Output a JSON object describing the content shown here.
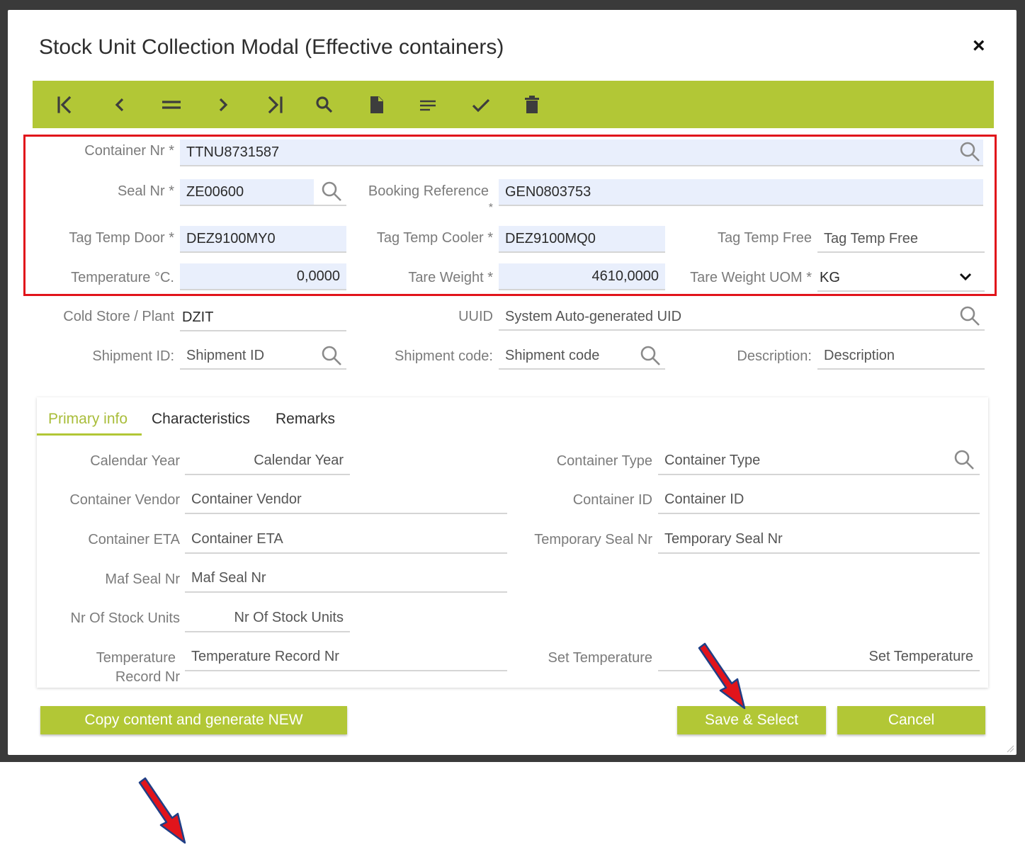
{
  "modal": {
    "title": "Stock Unit Collection Modal (Effective containers)",
    "close_label": "×"
  },
  "toolbar": {
    "icons": [
      "first-record-icon",
      "previous-record-icon",
      "list-view-icon",
      "next-record-icon",
      "last-record-icon",
      "search-icon",
      "new-document-icon",
      "details-icon",
      "confirm-icon",
      "delete-icon"
    ]
  },
  "form": {
    "container_nr": {
      "label": "Container Nr *",
      "value": "TTNU8731587"
    },
    "seal_nr": {
      "label": "Seal Nr *",
      "value": "ZE00600"
    },
    "booking_reference": {
      "label": "Booking Reference",
      "required_mark": "*",
      "value": "GEN0803753"
    },
    "tag_temp_door": {
      "label": "Tag Temp Door *",
      "value": "DEZ9100MY0"
    },
    "tag_temp_cooler": {
      "label": "Tag Temp Cooler *",
      "value": "DEZ9100MQ0"
    },
    "tag_temp_free": {
      "label": "Tag Temp Free",
      "placeholder": "Tag Temp Free"
    },
    "temperature": {
      "label": "Temperature °C.",
      "value": "0,0000"
    },
    "tare_weight": {
      "label": "Tare Weight *",
      "value": "4610,0000"
    },
    "tare_weight_uom": {
      "label": "Tare Weight UOM *",
      "value": "KG"
    },
    "cold_store": {
      "label": "Cold Store / Plant",
      "value": "DZIT"
    },
    "uuid": {
      "label": "UUID",
      "placeholder": "System Auto-generated UID"
    },
    "shipment_id": {
      "label": "Shipment ID:",
      "placeholder": "Shipment ID"
    },
    "shipment_code": {
      "label": "Shipment code:",
      "placeholder": "Shipment code"
    },
    "description": {
      "label": "Description:",
      "placeholder": "Description"
    }
  },
  "tabs": [
    {
      "label": "Primary info",
      "active": true
    },
    {
      "label": "Characteristics",
      "active": false
    },
    {
      "label": "Remarks",
      "active": false
    }
  ],
  "primary_info": {
    "calendar_year": {
      "label": "Calendar Year",
      "placeholder": "Calendar Year"
    },
    "container_type": {
      "label": "Container Type",
      "placeholder": "Container Type"
    },
    "container_vendor": {
      "label": "Container Vendor",
      "placeholder": "Container Vendor"
    },
    "container_id": {
      "label": "Container ID",
      "placeholder": "Container ID"
    },
    "container_eta": {
      "label": "Container ETA",
      "placeholder": "Container ETA"
    },
    "temporary_seal_nr": {
      "label": "Temporary Seal Nr",
      "placeholder": "Temporary Seal Nr"
    },
    "maf_seal_nr": {
      "label": "Maf Seal Nr",
      "placeholder": "Maf Seal Nr"
    },
    "nr_of_stock_units": {
      "label": "Nr Of Stock Units",
      "placeholder": "Nr Of Stock Units"
    },
    "temperature_record_nr": {
      "label_line1": "Temperature",
      "label_line2": "Record Nr",
      "placeholder": "Temperature Record Nr"
    },
    "set_temperature": {
      "label": "Set Temperature",
      "placeholder": "Set Temperature"
    }
  },
  "buttons": {
    "copy_generate": "Copy content and generate NEW",
    "save_select": "Save & Select",
    "cancel": "Cancel"
  },
  "colors": {
    "accent": "#b2c736",
    "highlight_border": "#e1141b",
    "field_fill": "#e9effc",
    "annotation_arrow": "#e1141b"
  }
}
